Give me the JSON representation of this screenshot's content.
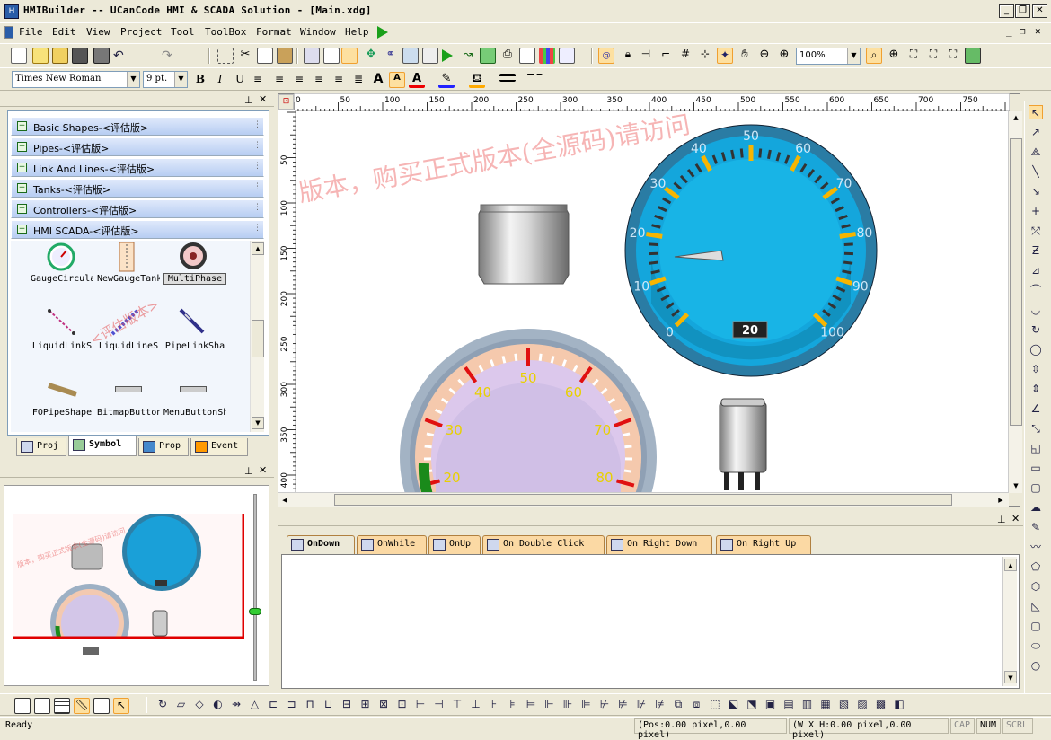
{
  "app": {
    "title": "HMIBuilder -- UCanCode HMI & SCADA Solution - [Main.xdg]",
    "icon": "app-icon"
  },
  "window_controls": {
    "minimize": "_",
    "restore": "❐",
    "close": "✕"
  },
  "menu": [
    "File",
    "Edit",
    "View",
    "Project",
    "Tool",
    "ToolBox",
    "Format",
    "Window",
    "Help"
  ],
  "mdi_controls": {
    "minimize": "_",
    "restore": "❐",
    "close": "✕"
  },
  "toolbar": {
    "zoom_value": "100%",
    "font_name": "Times New Roman",
    "font_size": "9 pt."
  },
  "ruler": {
    "h_ticks": [
      "0",
      "50",
      "100",
      "150",
      "200",
      "250",
      "300",
      "350",
      "400",
      "450",
      "500",
      "550",
      "600",
      "650",
      "700",
      "750"
    ],
    "v_ticks": [
      "50",
      "100",
      "150",
      "200",
      "250",
      "300",
      "350",
      "400"
    ]
  },
  "symbol_panel": {
    "categories": [
      "Basic Shapes-<评估版>",
      "Pipes-<评估版>",
      "Link And Lines-<评估版>",
      "Tanks-<评估版>",
      "Controllers-<评估版>",
      "HMI SCADA-<评估版>"
    ],
    "symbols": [
      "GaugeCircular",
      "NewGaugeTank",
      "MultiPhase",
      "LiquidLinkS",
      "LiquidLineS",
      "PipeLinkSha",
      "FOPipeShape",
      "BitmapButtonS",
      "MenuButtonSh"
    ],
    "watermark": "<评估版本>"
  },
  "panel_tabs": [
    "Proj",
    "Symbol",
    "Prop",
    "Event"
  ],
  "canvas": {
    "watermark": "版本，购买正式版本(全源码)请访问",
    "gauge1": {
      "scale_labels": [
        "0",
        "10",
        "20",
        "30",
        "40",
        "50",
        "60",
        "70",
        "80",
        "90",
        "100"
      ],
      "value": "20"
    },
    "gauge2": {
      "scale_labels": [
        "20",
        "30",
        "40",
        "50",
        "60",
        "70",
        "80"
      ]
    }
  },
  "event_tabs": [
    "OnDown",
    "OnWhile",
    "OnUp",
    "On Double Click",
    "On Right Down",
    "On Right Up"
  ],
  "preview": {
    "watermark": "版本，购买正式版本(全源码)请访问"
  },
  "status": {
    "ready": "Ready",
    "pos": "(Pos:0.00 pixel,0.00 pixel)",
    "size": "(W X H:0.00 pixel,0.00 pixel)",
    "cap": "CAP",
    "num": "NUM",
    "scrl": "SCRL"
  },
  "colors": {
    "accent": "#316ac5",
    "gauge_blue": "#1aa0d8",
    "gauge_rim": "#2c80a8",
    "preview_red": "#e00000"
  }
}
